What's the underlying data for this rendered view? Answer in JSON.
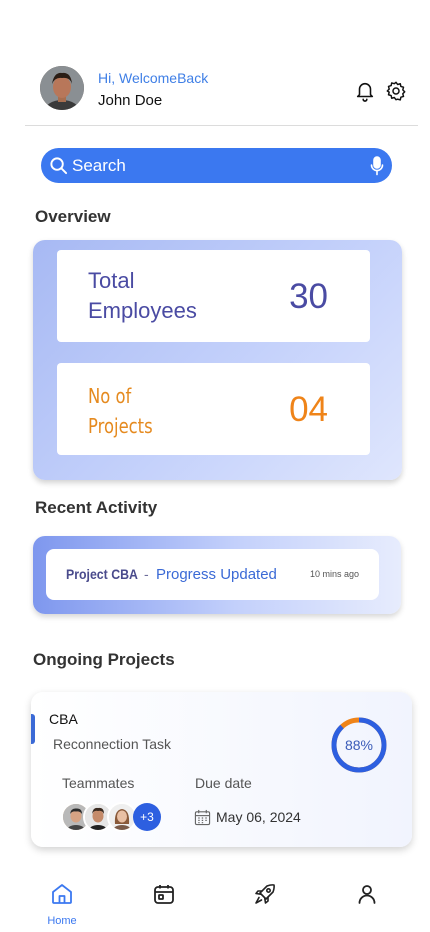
{
  "header": {
    "greeting": "Hi, WelcomeBack",
    "user_name": "John Doe",
    "icons": [
      "bell-icon",
      "gear-icon"
    ]
  },
  "search": {
    "placeholder": "Search",
    "icons": [
      "search-icon",
      "microphone-icon"
    ]
  },
  "overview": {
    "title": "Overview",
    "employees": {
      "label_line1": "Total",
      "label_line2": "Employees",
      "value": "30"
    },
    "projects": {
      "label_line1": "No of",
      "label_line2": "Projects",
      "value": "04"
    }
  },
  "recent_activity": {
    "title": "Recent Activity",
    "item": {
      "project": "Project CBA",
      "separator": "-",
      "description": "Progress Updated",
      "time": "10 mins ago"
    }
  },
  "ongoing_projects": {
    "title": "Ongoing Projects",
    "project": {
      "name": "CBA",
      "task": "Reconnection Task",
      "progress_label": "88%",
      "progress": 0.88,
      "teammates_label": "Teammates",
      "extra_teammates": "+3",
      "due_label": "Due date",
      "due_date": "May 06, 2024"
    }
  },
  "bottom_nav": {
    "items": [
      {
        "icon": "home-icon",
        "label": "Home",
        "active": true
      },
      {
        "icon": "calendar-icon",
        "label": "",
        "active": false
      },
      {
        "icon": "rocket-icon",
        "label": "",
        "active": false
      },
      {
        "icon": "profile-icon",
        "label": "",
        "active": false
      }
    ]
  },
  "colors": {
    "accent": "#3b78f0",
    "employees_text": "#4a4ba3",
    "projects_text": "#ef8419",
    "progress_ring_blue": "#2d5fe0",
    "progress_ring_orange": "#ef8419"
  }
}
